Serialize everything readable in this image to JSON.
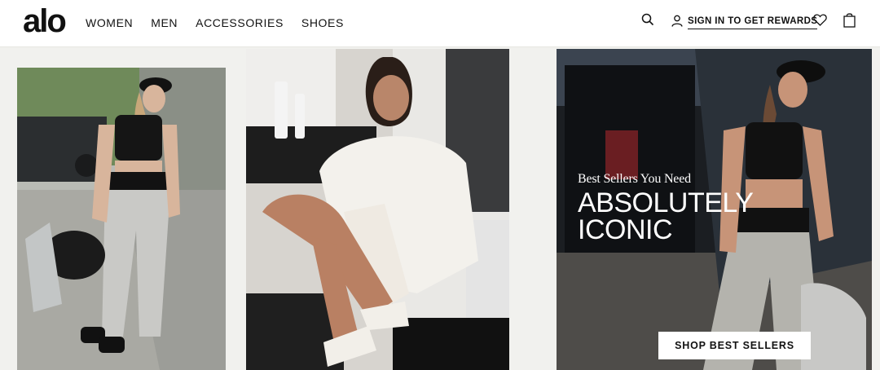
{
  "brand": {
    "logo_text": "alo"
  },
  "nav": {
    "items": [
      {
        "label": "WOMEN"
      },
      {
        "label": "MEN"
      },
      {
        "label": "ACCESSORIES"
      },
      {
        "label": "SHOES"
      }
    ]
  },
  "header_actions": {
    "search_icon": "search-icon",
    "signin_label": "SIGN IN TO GET REWARDS",
    "account_icon": "user-icon",
    "wishlist_icon": "heart-icon",
    "bag_icon": "shopping-bag-icon"
  },
  "promo": {
    "eyebrow": "Best Sellers You Need",
    "headline_line1": "ABSOLUTELY",
    "headline_line2": "ICONIC",
    "cta_label": "SHOP BEST SELLERS"
  },
  "colors": {
    "page_background": "#f1f1ee",
    "header_background": "#ffffff",
    "text": "#111111",
    "cta_background": "#ffffff"
  }
}
